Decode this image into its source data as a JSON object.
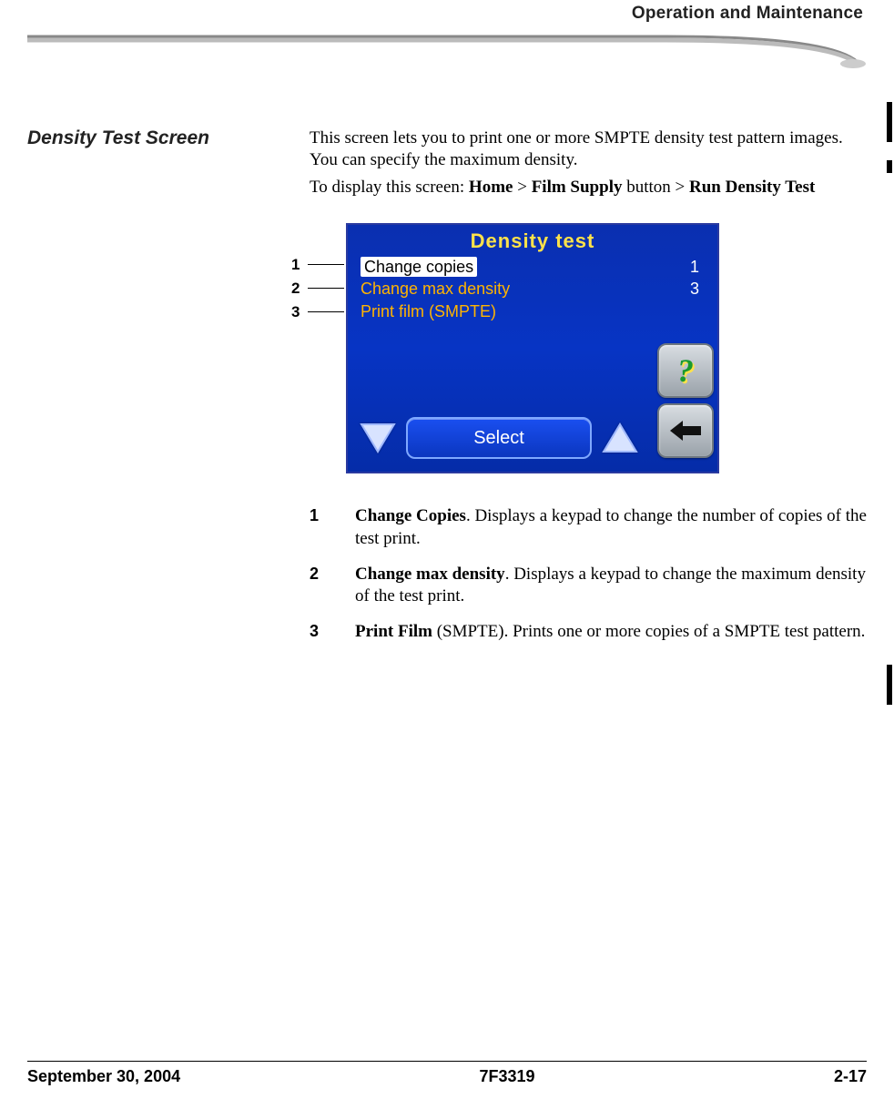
{
  "header": {
    "section": "Operation and Maintenance"
  },
  "title": "Density Test Screen",
  "intro": {
    "p1": "This screen lets you to print one or more SMPTE density test pattern images. You can specify the maximum density.",
    "p2_prefix": "To display this screen: ",
    "path_a": "Home",
    "sep1": " > ",
    "path_b": "Film Supply",
    "mid": " button > ",
    "path_c": "Run Density Test"
  },
  "callouts": [
    "1",
    "2",
    "3"
  ],
  "device": {
    "title": "Density test",
    "rows": [
      {
        "label": "Change copies",
        "value": "1",
        "selected": true
      },
      {
        "label": "Change max density",
        "value": "3",
        "selected": false
      },
      {
        "label": "Print film (SMPTE)",
        "value": "",
        "selected": false
      }
    ],
    "select": "Select"
  },
  "defs": [
    {
      "n": "1",
      "bold": "Change Copies",
      "rest": ". Displays a keypad to change the number of copies of the test print."
    },
    {
      "n": "2",
      "bold": "Change max density",
      "rest": ". Displays a keypad to change the maximum density of the test print."
    },
    {
      "n": "3",
      "bold": "Print Film",
      "rest": " (SMPTE). Prints one or more copies of a SMPTE test pattern."
    }
  ],
  "footer": {
    "date": "September 30, 2004",
    "docnum": "7F3319",
    "page": "2-17"
  }
}
